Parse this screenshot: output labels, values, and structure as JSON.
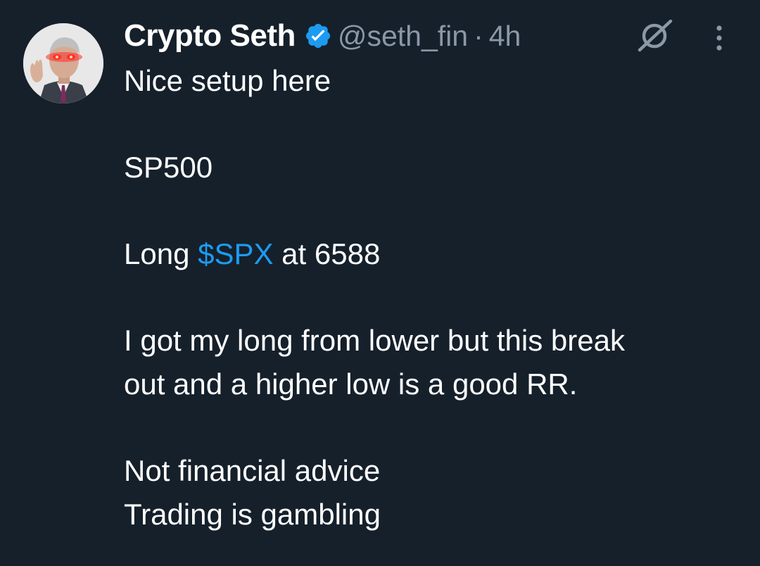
{
  "tweet": {
    "display_name": "Crypto Seth",
    "handle": "@seth_fin",
    "separator": "·",
    "time": "4h",
    "verified": true,
    "lines": {
      "l1": "Nice setup here",
      "l2": "SP500",
      "l3_prefix": "Long ",
      "l3_cashtag": "$SPX",
      "l3_suffix": " at 6588",
      "l4a": "I got my long from lower but this break",
      "l4b": "out and a higher low is a good RR.",
      "l5": "Not financial advice",
      "l6": "Trading is gambling"
    }
  },
  "colors": {
    "background": "#15202b",
    "text": "#ffffff",
    "muted": "#8b98a5",
    "accent": "#1d9bf0"
  },
  "icons": {
    "verified": "verified-badge-icon",
    "grok": "grok-icon",
    "more": "more-dots-icon"
  }
}
